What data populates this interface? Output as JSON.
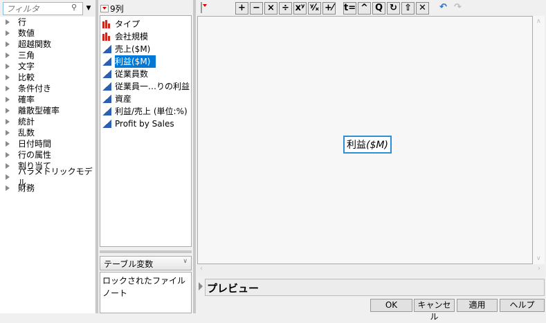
{
  "filter": {
    "placeholder": "フィルタ"
  },
  "functions": [
    "行",
    "数値",
    "超越関数",
    "三角",
    "文字",
    "比較",
    "条件付き",
    "確率",
    "離散型確率",
    "統計",
    "乱数",
    "日付時間",
    "行の属性",
    "割り当て",
    "パラメトリックモデル",
    "財務"
  ],
  "columns": {
    "count_label": "9列",
    "items": [
      {
        "name": "タイプ",
        "type": "nominal"
      },
      {
        "name": "会社規模",
        "type": "nominal"
      },
      {
        "name": "売上($M)",
        "type": "continuous"
      },
      {
        "name": "利益($M)",
        "type": "continuous",
        "selected": true
      },
      {
        "name": "従業員数",
        "type": "continuous"
      },
      {
        "name": "従業員一…りの利益",
        "type": "continuous"
      },
      {
        "name": "資産",
        "type": "continuous"
      },
      {
        "name": "利益/売上 (単位:%)",
        "type": "continuous"
      },
      {
        "name": "Profit by Sales",
        "type": "continuous"
      }
    ]
  },
  "table_vars": {
    "selected": "テーブル変数",
    "items": [
      "ロックされたファイル",
      "ノート"
    ]
  },
  "toolbar": [
    "+",
    "−",
    "×",
    "÷",
    "xʸ",
    "ʸ⁄ₓ",
    "+⁄−",
    "t=",
    "^",
    "Q",
    "↻",
    "⇧",
    "✕",
    "↶",
    "↷"
  ],
  "formula": {
    "text": "利益",
    "unit": "($M)"
  },
  "preview": "プレビュー",
  "buttons": {
    "ok": "OK",
    "cancel": "キャンセル",
    "apply": "適用",
    "help": "ヘルプ"
  }
}
